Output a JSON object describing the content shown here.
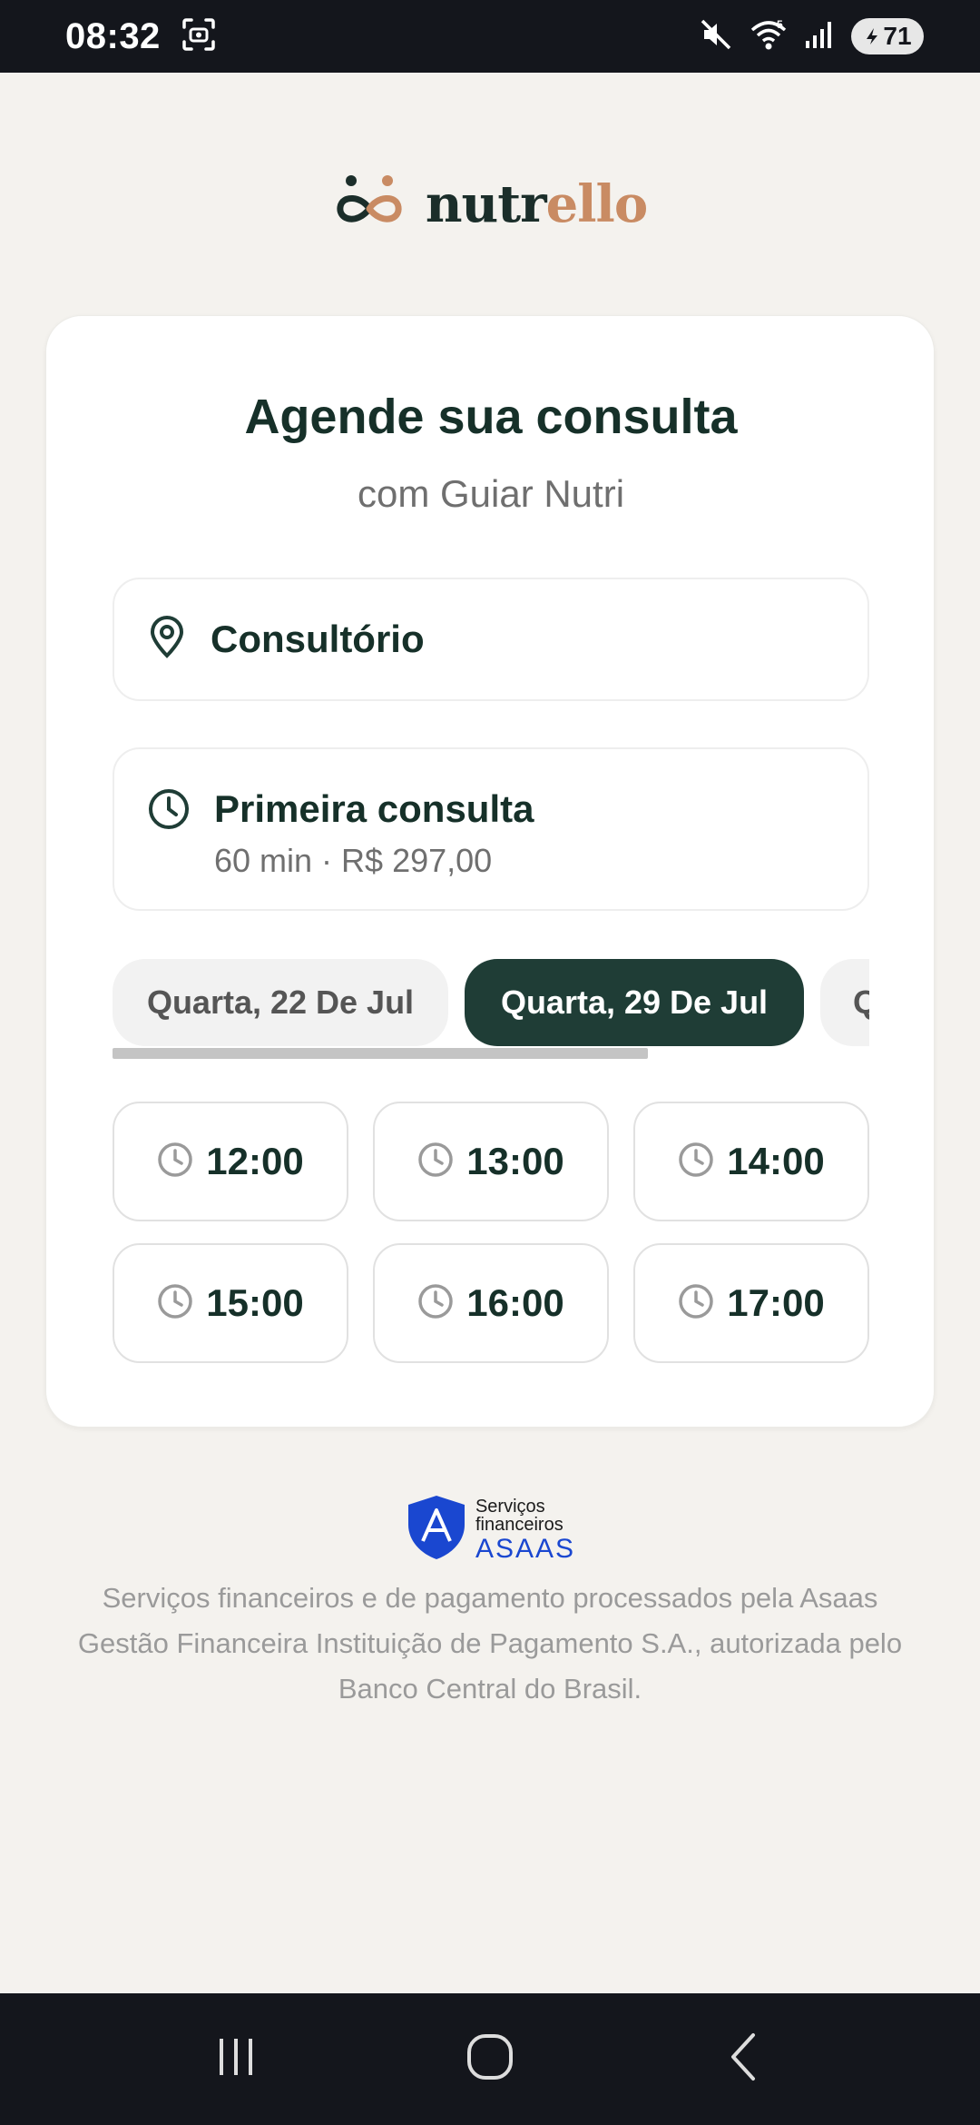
{
  "status_bar": {
    "time": "08:32",
    "battery": "71",
    "icons": [
      "screenshot-icon",
      "mute-icon",
      "wifi-icon",
      "signal-icon",
      "battery-icon"
    ]
  },
  "logo": {
    "text_dark": "nutr",
    "text_accent": "ello",
    "colors": {
      "dark": "#1b2e2a",
      "accent": "#c98b63"
    }
  },
  "card": {
    "title": "Agende sua consulta",
    "subtitle": "com Guiar Nutri",
    "location": {
      "label": "Consultório",
      "icon": "location-pin-icon"
    },
    "service": {
      "title": "Primeira consulta",
      "details": "60 min · R$ 297,00",
      "icon": "clock-icon"
    },
    "dates": [
      {
        "label": "Quarta, 22 De Jul",
        "selected": false
      },
      {
        "label": "Quarta, 29 De Jul",
        "selected": true
      },
      {
        "label": "Q",
        "selected": false
      }
    ],
    "times": [
      "12:00",
      "13:00",
      "14:00",
      "15:00",
      "16:00",
      "17:00"
    ]
  },
  "footer": {
    "badge_line1": "Serviços",
    "badge_line2": "financeiros",
    "badge_brand": "ASAAS",
    "legal": "Serviços financeiros e de pagamento processados pela Asaas Gestão Financeira Instituição de Pagamento S.A., autorizada pelo Banco Central do Brasil."
  },
  "theme": {
    "primary": "#1f3d36",
    "background": "#f4f2ee",
    "asaas_blue": "#1a47d0"
  }
}
